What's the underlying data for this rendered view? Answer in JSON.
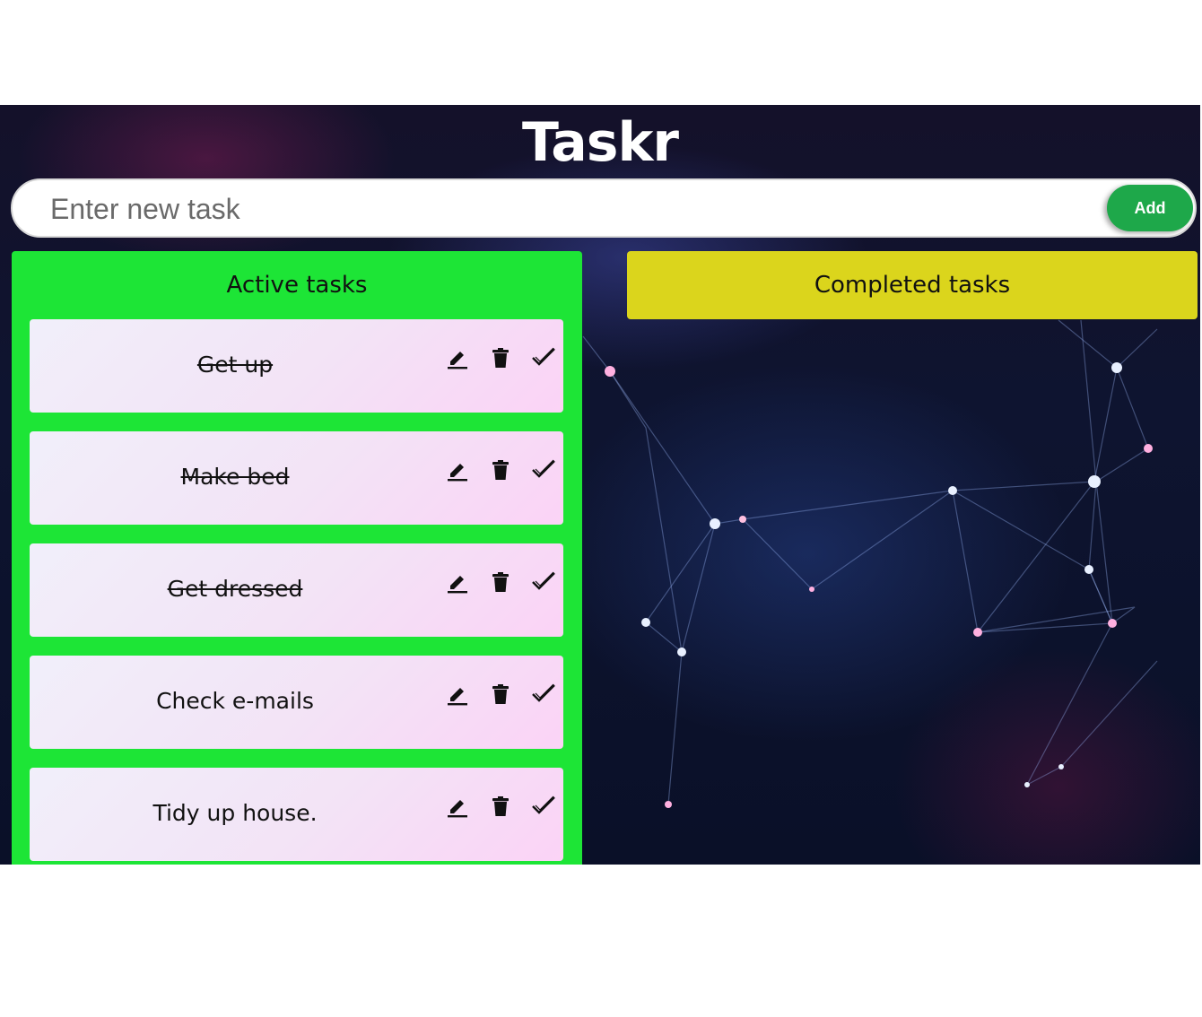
{
  "app": {
    "title": "Taskr"
  },
  "new_task": {
    "placeholder": "Enter new task",
    "add_label": "Add"
  },
  "active": {
    "heading": "Active tasks",
    "tasks": [
      {
        "text": "Get up",
        "struck": true
      },
      {
        "text": "Make bed",
        "struck": true
      },
      {
        "text": "Get dressed",
        "struck": true
      },
      {
        "text": "Check e-mails",
        "struck": false
      },
      {
        "text": "Tidy up house.",
        "struck": false
      }
    ],
    "actions": [
      "pencil-icon",
      "trash-icon",
      "checkmark-icon"
    ]
  },
  "completed": {
    "heading": "Completed tasks",
    "tasks": []
  },
  "colors": {
    "active_column": "#1de536",
    "completed_column": "#dbd51c",
    "add_button": "#1ea84a",
    "card_gradient_start": "#f1effa",
    "card_gradient_end": "#fbd3f6"
  }
}
